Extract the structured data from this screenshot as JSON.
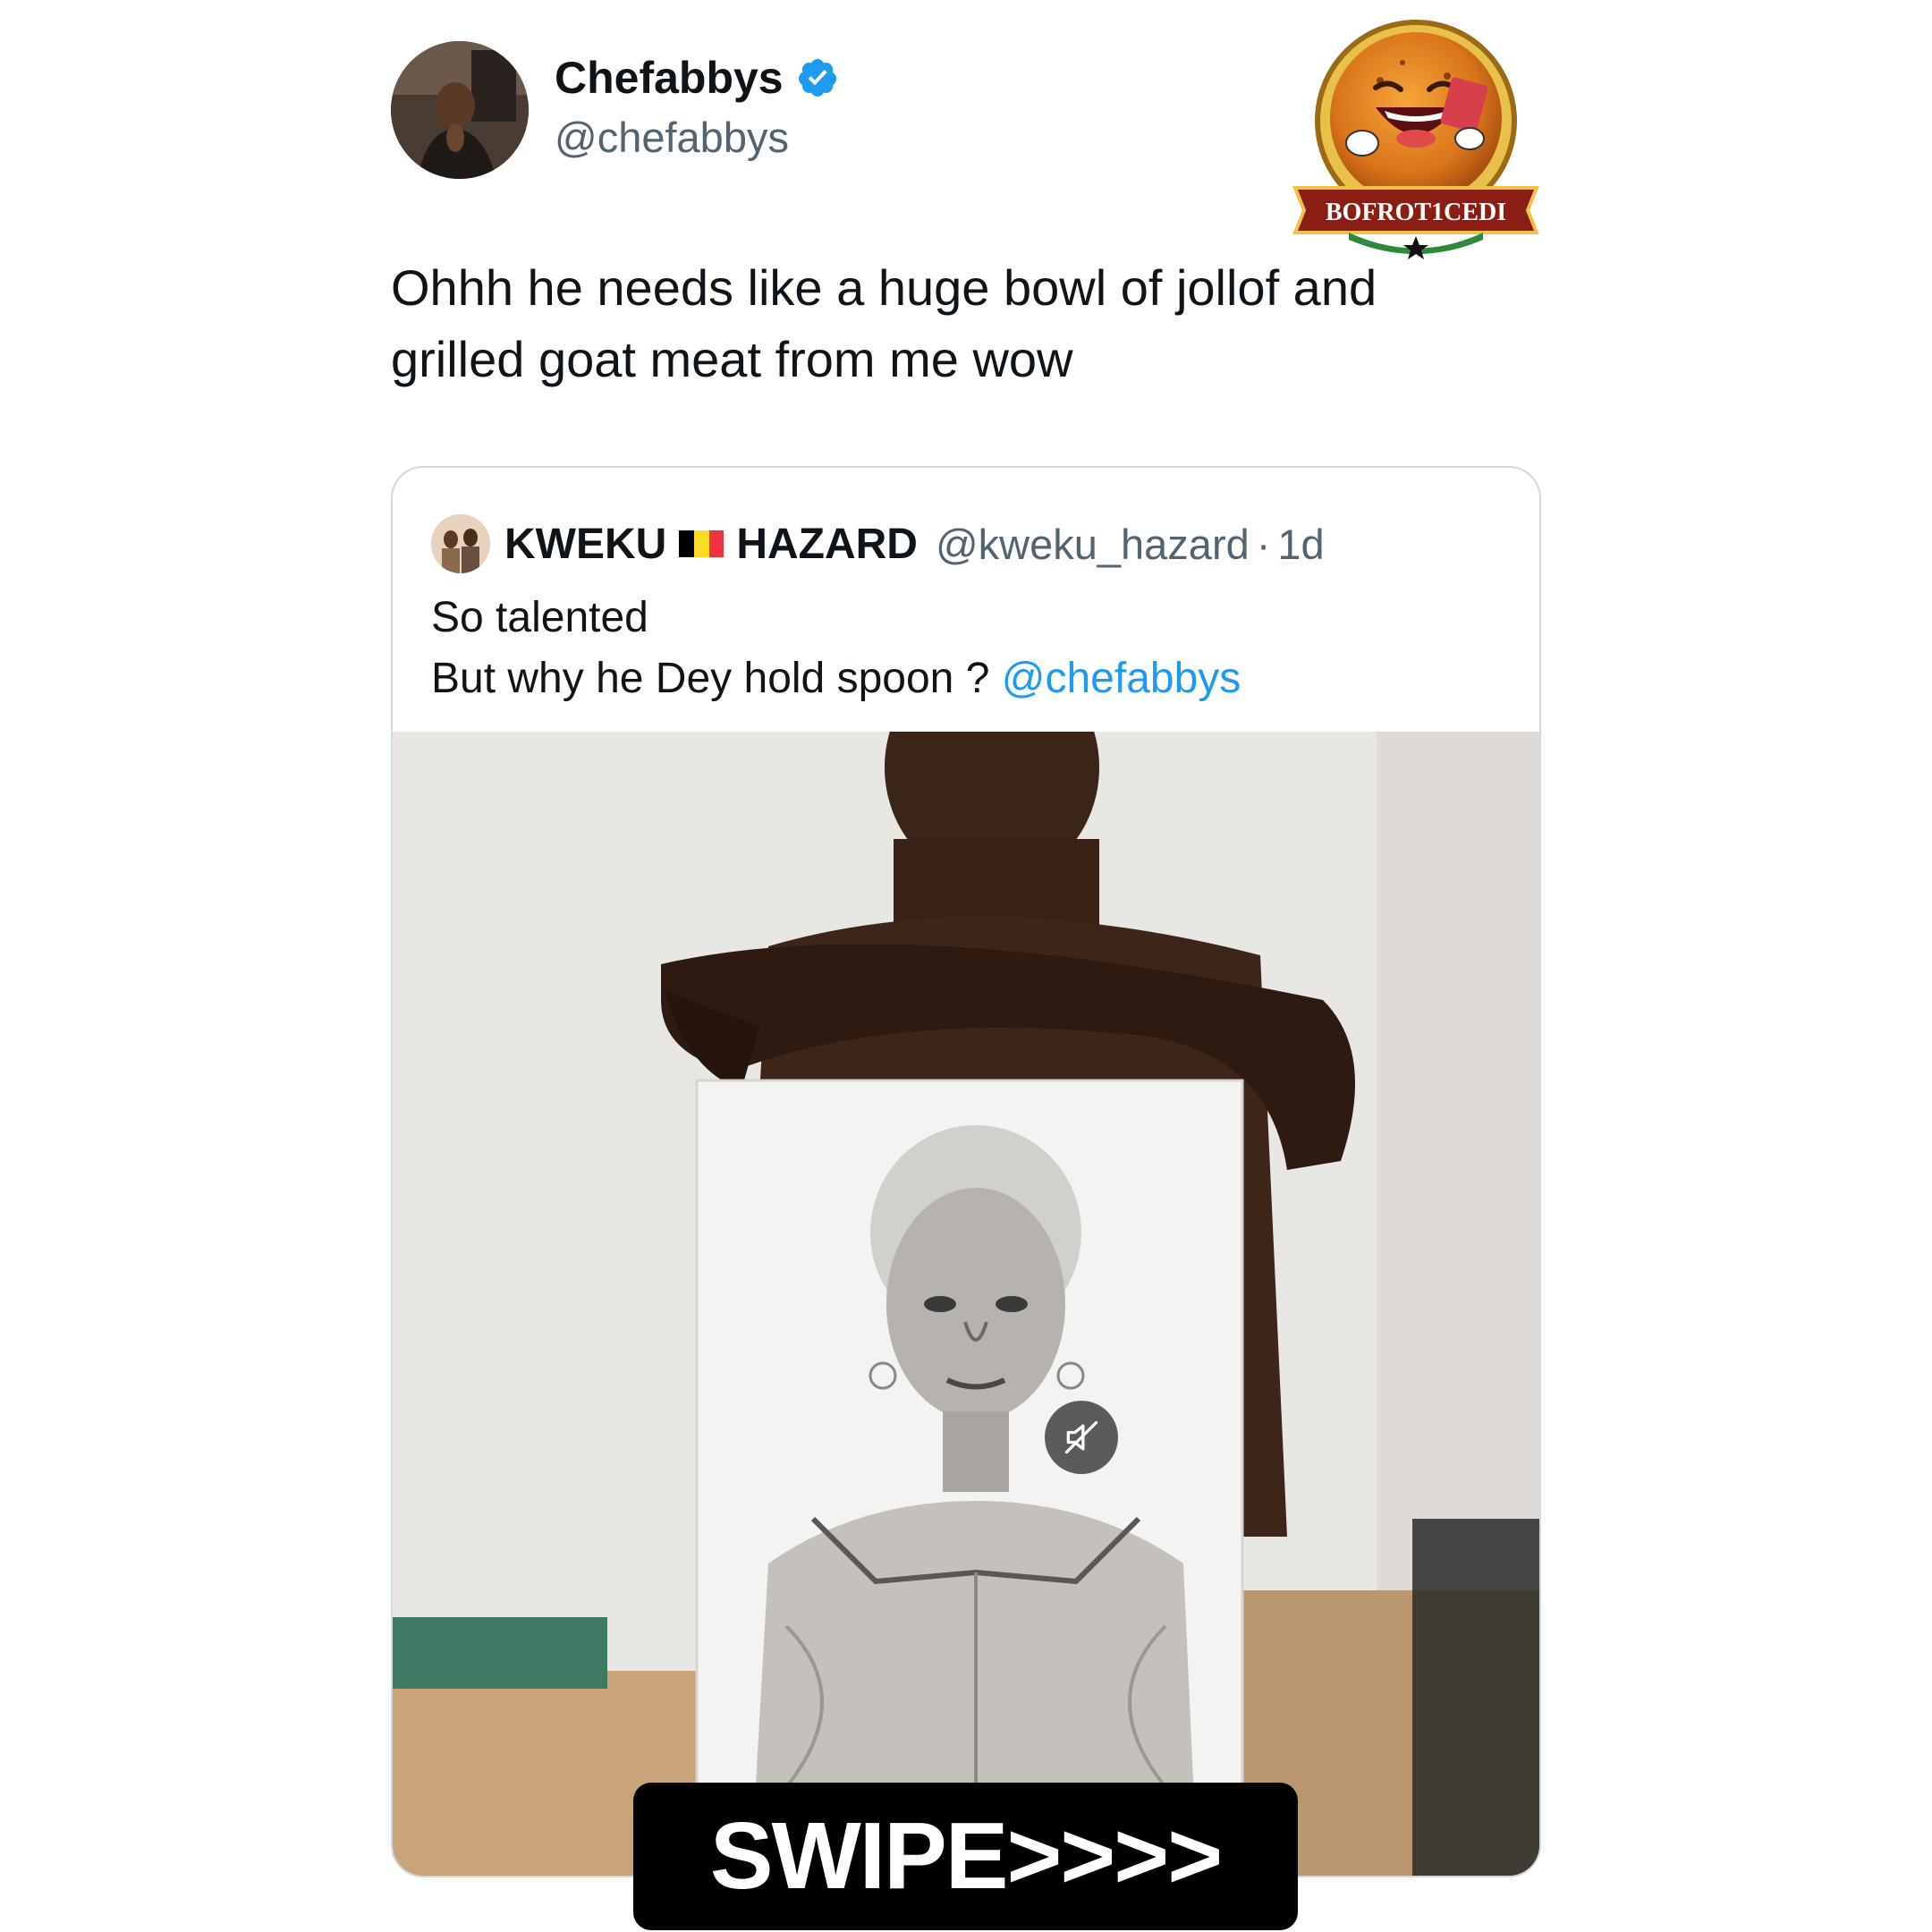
{
  "author": {
    "display_name": "Chefabbys",
    "handle": "@chefabbys",
    "verified": true
  },
  "logo": {
    "text": "BOFROT1CEDI"
  },
  "tweet": {
    "text_line1": "Ohhh he needs like a huge bowl of jollof and",
    "text_line2": "grilled goat meat from me  wow"
  },
  "quoted_tweet": {
    "name_part1": "KWEKU",
    "name_part2": "HAZARD",
    "handle": "@kweku_hazard",
    "separator": "·",
    "time": "1d",
    "line1": "So talented",
    "line2_prefix": "But why he Dey hold spoon ? ",
    "mention": "@chefabbys",
    "flag_colors": [
      "#000000",
      "#fdda24",
      "#ef3340"
    ]
  },
  "overlay": {
    "swipe_label": "SWIPE>>>>"
  },
  "colors": {
    "link": "#1d9bf0",
    "secondary_text": "#536471",
    "verified_badge": "#1d9bf0"
  },
  "icons": {
    "verified": "verified-badge-icon",
    "mute": "muted-speaker-icon"
  }
}
